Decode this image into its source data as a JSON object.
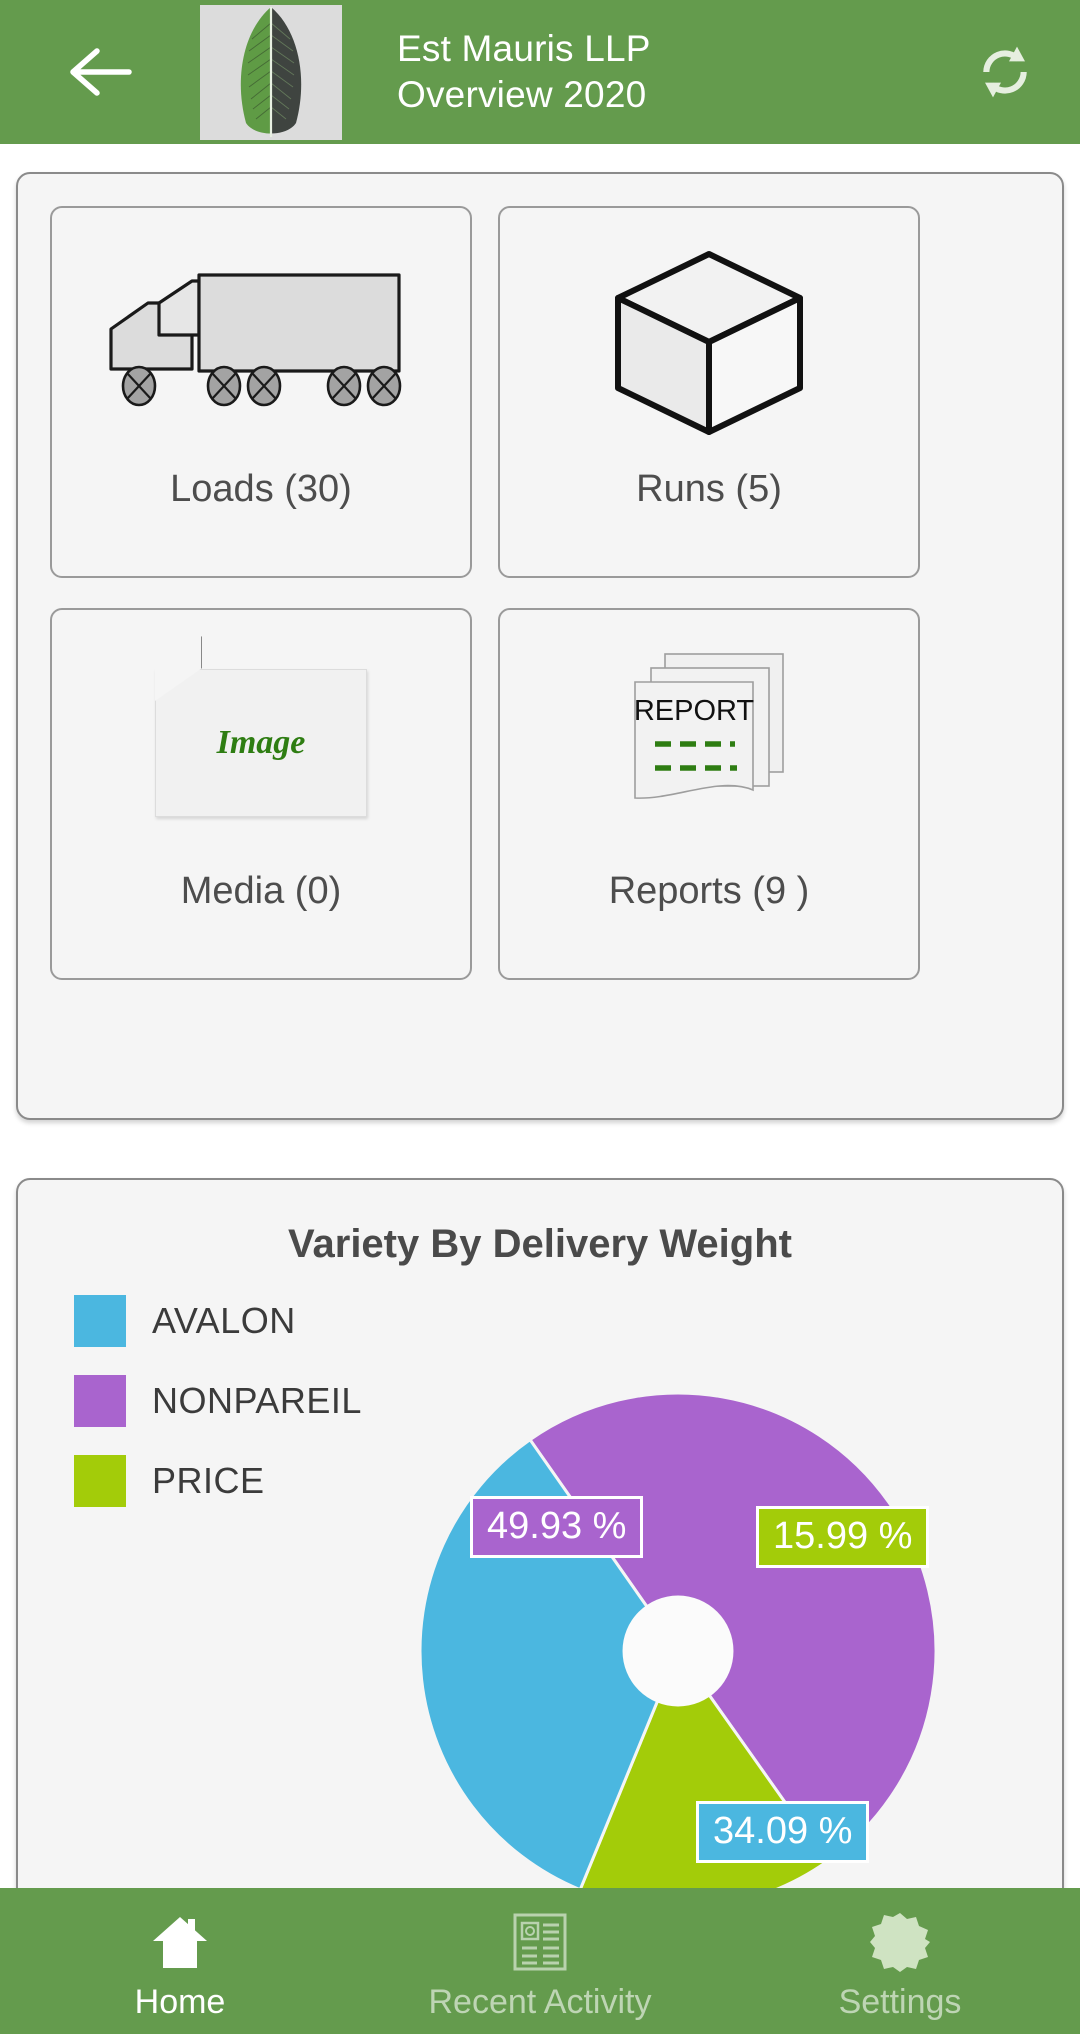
{
  "theme": {
    "brand_green": "#649B4D",
    "card_bg": "#f5f5f5",
    "page_bg": "#ffffff",
    "label_gray": "#4d4d4d"
  },
  "header": {
    "back_icon": "arrow-left-icon",
    "logo_icon": "leaf-logo",
    "title": "Est Mauris LLP",
    "subtitle": "Overview 2020",
    "refresh_icon": "refresh-icon"
  },
  "tiles": [
    {
      "label": "Loads (30)",
      "icon": "truck-icon",
      "name": "loads"
    },
    {
      "label": "Runs (5)",
      "icon": "cube-icon",
      "name": "runs"
    },
    {
      "label": "Media (0)",
      "icon": "image-placeholder-icon",
      "icon_text": "Image",
      "name": "media"
    },
    {
      "label": "Reports (9 )",
      "icon": "reports-stack-icon",
      "icon_text": "REPORT",
      "name": "reports"
    }
  ],
  "chart_data": {
    "type": "pie",
    "title": "Variety By Delivery Weight",
    "xlabel": "",
    "ylabel": "",
    "grid": false,
    "legend_position": "left",
    "donut": true,
    "donut_hole_ratio": 0.215,
    "start_angle_deg": -125,
    "categories": [
      "AVALON",
      "NONPAREIL",
      "PRICE"
    ],
    "values": [
      34.09,
      49.93,
      15.99
    ],
    "labels": [
      "34.09 %",
      "49.93 %",
      "15.99 %"
    ],
    "colors": [
      "#4BB7E0",
      "#A964CE",
      "#A3CC09"
    ],
    "slice_order": [
      "NONPAREIL",
      "PRICE",
      "AVALON"
    ],
    "slices": [
      {
        "name": "NONPAREIL",
        "value": 49.93,
        "label": "49.93 %",
        "color": "#A964CE"
      },
      {
        "name": "PRICE",
        "value": 15.99,
        "label": "15.99 %",
        "color": "#A3CC09"
      },
      {
        "name": "AVALON",
        "value": 34.09,
        "label": "34.09 %",
        "color": "#4BB7E0"
      }
    ]
  },
  "bottom_nav": {
    "items": [
      {
        "label": "Home",
        "icon": "home-icon",
        "active": true
      },
      {
        "label": "Recent Activity",
        "icon": "article-list-icon",
        "active": false
      },
      {
        "label": "Settings",
        "icon": "gear-icon",
        "active": false
      }
    ]
  }
}
